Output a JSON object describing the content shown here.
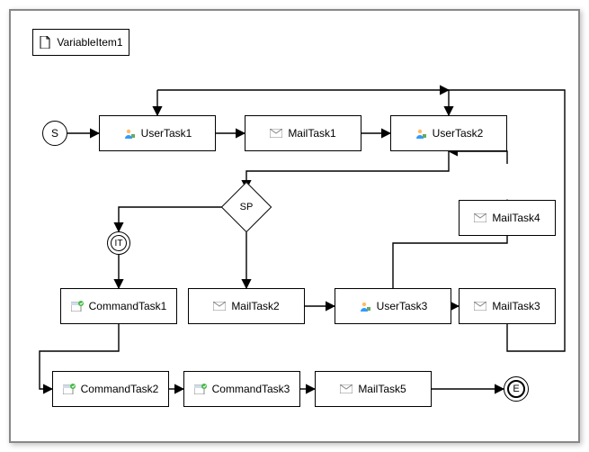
{
  "diagram": {
    "variableItem": "VariableItem1",
    "startEvent": "S",
    "intermediateEvent": "IT",
    "endEvent": "E",
    "gateway": "SP",
    "tasks": {
      "userTask1": "UserTask1",
      "mailTask1": "MailTask1",
      "userTask2": "UserTask2",
      "commandTask1": "CommandTask1",
      "mailTask2": "MailTask2",
      "userTask3": "UserTask3",
      "mailTask3": "MailTask3",
      "mailTask4": "MailTask4",
      "commandTask2": "CommandTask2",
      "commandTask3": "CommandTask3",
      "mailTask5": "MailTask5"
    },
    "icons": {
      "user": "user-icon",
      "mail": "mail-icon",
      "command": "command-icon",
      "document": "document-icon"
    }
  }
}
